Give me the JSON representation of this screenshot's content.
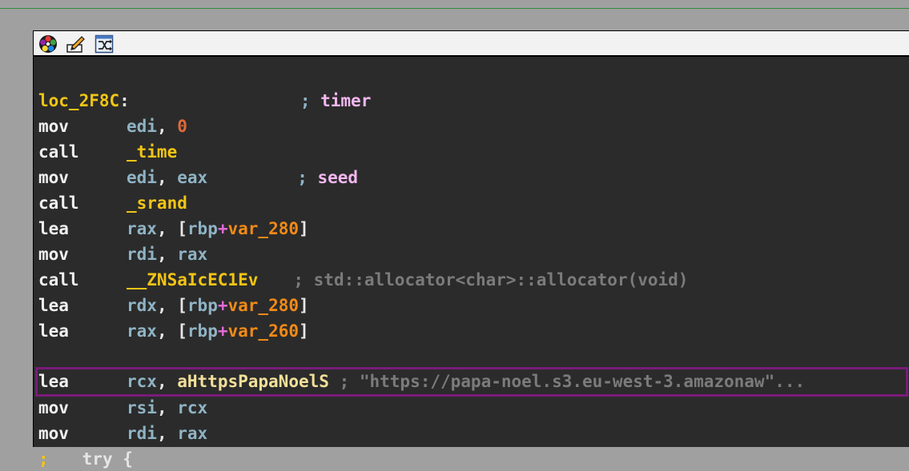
{
  "toolbar": {
    "icons": [
      "graph-overview-icon",
      "edit-icon",
      "switch-view-icon"
    ]
  },
  "lines": [
    {
      "label": "loc_2F8C",
      "colon": ":",
      "semi": ";",
      "comment": "timer"
    },
    {
      "mn": "mov",
      "op1": "edi",
      "sep": ",",
      "op2": "0"
    },
    {
      "mn": "call",
      "func": "_time"
    },
    {
      "mn": "mov",
      "op1": "edi",
      "sep": ",",
      "op2": "eax",
      "semi": ";",
      "comment": "seed"
    },
    {
      "mn": "call",
      "func": "_srand"
    },
    {
      "mn": "lea",
      "op1": "rax",
      "sep": ",",
      "lb": "[",
      "base": "rbp",
      "plus": "+",
      "var": "var_280",
      "rb": "]"
    },
    {
      "mn": "mov",
      "op1": "rdi",
      "sep": ",",
      "op2": "rax"
    },
    {
      "mn": "call",
      "func": "__ZNSaIcEC1Ev",
      "comment": "; std::allocator<char>::allocator(void)"
    },
    {
      "mn": "lea",
      "op1": "rdx",
      "sep": ",",
      "lb": "[",
      "base": "rbp",
      "plus": "+",
      "var": "var_280",
      "rb": "]"
    },
    {
      "mn": "lea",
      "op1": "rax",
      "sep": ",",
      "lb": "[",
      "base": "rbp",
      "plus": "+",
      "var": "var_260",
      "rb": "]"
    },
    {
      "mn": "lea",
      "op1": "rcx",
      "sep": ",",
      "name": "aHttpsPapaNoelS",
      "comment": "; \"https://papa-noel.s3.eu-west-3.amazonaw\"..."
    },
    {
      "mn": "mov",
      "op1": "rsi",
      "sep": ",",
      "op2": "rcx"
    },
    {
      "mn": "mov",
      "op1": "rdi",
      "sep": ",",
      "op2": "rax"
    },
    {
      "semi": ";",
      "text": "try {"
    }
  ]
}
